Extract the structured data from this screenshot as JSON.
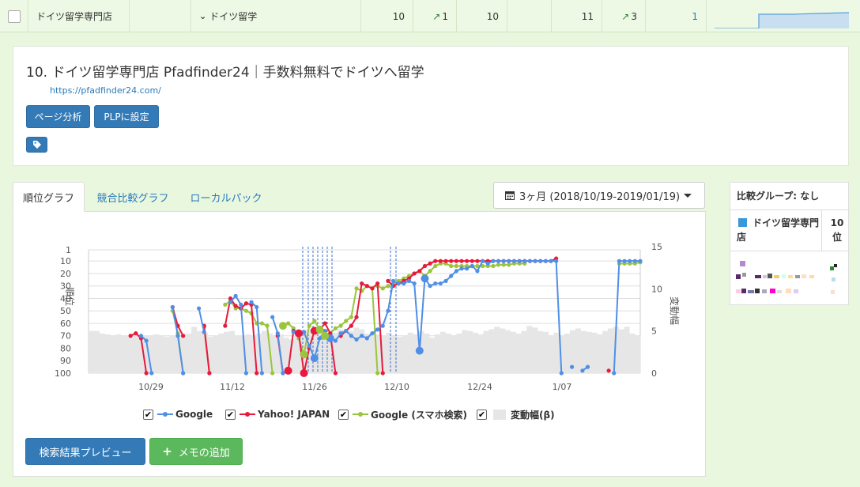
{
  "top_row": {
    "site_name": "ドイツ留学専門店",
    "keyword": "ドイツ留学",
    "rank_google": "10",
    "change_google": "1",
    "rank_yahoo": "10",
    "rank_mobile": "11",
    "change_mobile": "3",
    "count": "1"
  },
  "result": {
    "title": "10. ドイツ留学専門店 Pfadfinder24｜手数料無料でドイツへ留学",
    "url": "https://pfadfinder24.com/",
    "page_analysis_label": "ページ分析",
    "plp_label": "PLPに設定"
  },
  "tabs": [
    {
      "label": "順位グラフ"
    },
    {
      "label": "競合比較グラフ"
    },
    {
      "label": "ローカルパック"
    }
  ],
  "period": {
    "label": "3ヶ月 (2018/10/19-2019/01/19)"
  },
  "chart_data": {
    "type": "line",
    "ylabel": "順位",
    "y2label": "変動幅",
    "y_ticks": [
      "1",
      "10",
      "20",
      "30",
      "40",
      "50",
      "60",
      "70",
      "80",
      "90",
      "100"
    ],
    "y2_ticks": [
      "15",
      "10",
      "5",
      "0"
    ],
    "x_ticks": [
      "10/29",
      "11/12",
      "11/26",
      "12/10",
      "12/24",
      "1/07"
    ],
    "series": [
      {
        "name": "Google",
        "color": "#4f8fe6"
      },
      {
        "name": "Yahoo! JAPAN",
        "color": "#e8193c"
      },
      {
        "name": "Google (スマホ検索)",
        "color": "#9bc53d"
      },
      {
        "name": "変動幅(β)",
        "color": "#e6e6e6"
      }
    ],
    "volatility": [
      5,
      5,
      4.7,
      4.6,
      4.5,
      4.6,
      4.4,
      4.5,
      4.6,
      4.5,
      4.4,
      4.5,
      4.6,
      4.4,
      4.3,
      4.4,
      4.5,
      4.6,
      4.7,
      5.5,
      5,
      4.8,
      4.3,
      4.5,
      4.7,
      4.9,
      5,
      4.5,
      4.4,
      4.6,
      4.5,
      4.7,
      5,
      4.7,
      4.4,
      4.6,
      4.2,
      4,
      4.5,
      5,
      5.2,
      5,
      4.8,
      4.6,
      4.4,
      4.8,
      5.2,
      5.1,
      5,
      5.4,
      5.2,
      4.7,
      4.8,
      4.6,
      4.4,
      4.8,
      4.5,
      4.3,
      4.5,
      4.8,
      4.6,
      5,
      4.7,
      4.2,
      4.6,
      4.9,
      4.7,
      4.5,
      4.7,
      5.1,
      5,
      4.8,
      4.6,
      5,
      5.2,
      5.5,
      5.3,
      5.1,
      4.9,
      4.7,
      5,
      5.6,
      5.4,
      5,
      4.9,
      4.5,
      4.8,
      4.4,
      4.7,
      5.1,
      5.3,
      5,
      4.9,
      4.8,
      4.6,
      5,
      5.3,
      5.5,
      5.2,
      5.5,
      4.7,
      4.4
    ],
    "google_segments": [
      [
        [
          10,
          70
        ],
        [
          11,
          74
        ],
        [
          12,
          100
        ]
      ],
      [
        [
          16,
          47
        ],
        [
          17,
          70
        ],
        [
          18,
          100
        ]
      ],
      [
        [
          21,
          48
        ],
        [
          22,
          67
        ]
      ],
      [
        [
          27,
          43
        ],
        [
          28,
          38
        ],
        [
          29,
          45
        ],
        [
          30,
          100
        ]
      ],
      [
        [
          31,
          43
        ],
        [
          32,
          47
        ],
        [
          33,
          100
        ]
      ],
      [
        [
          35,
          55
        ],
        [
          36,
          68
        ],
        [
          37,
          100
        ]
      ],
      [
        [
          39,
          67
        ],
        [
          40,
          70
        ],
        [
          41,
          67
        ],
        [
          42,
          78
        ],
        [
          43,
          88
        ],
        [
          44,
          72
        ],
        [
          45,
          66
        ],
        [
          46,
          72
        ],
        [
          47,
          74
        ],
        [
          48,
          68
        ],
        [
          49,
          66
        ],
        [
          50,
          70
        ],
        [
          51,
          73
        ],
        [
          52,
          70
        ],
        [
          53,
          72
        ],
        [
          54,
          68
        ],
        [
          55,
          65
        ],
        [
          56,
          62
        ],
        [
          57,
          50
        ],
        [
          58,
          26
        ],
        [
          59,
          28
        ],
        [
          60,
          28
        ],
        [
          61,
          26
        ],
        [
          62,
          28
        ],
        [
          63,
          82
        ],
        [
          64,
          24
        ],
        [
          65,
          30
        ],
        [
          66,
          28
        ],
        [
          67,
          28
        ],
        [
          68,
          26
        ],
        [
          69,
          22
        ],
        [
          70,
          18
        ],
        [
          71,
          16
        ],
        [
          72,
          16
        ],
        [
          73,
          14
        ],
        [
          74,
          18
        ],
        [
          75,
          10
        ],
        [
          76,
          12
        ],
        [
          77,
          10
        ],
        [
          78,
          10
        ],
        [
          79,
          10
        ],
        [
          80,
          10
        ],
        [
          81,
          10
        ],
        [
          82,
          10
        ],
        [
          83,
          10
        ],
        [
          84,
          10
        ],
        [
          85,
          10
        ],
        [
          86,
          10
        ],
        [
          87,
          10
        ],
        [
          88,
          10
        ],
        [
          89,
          10
        ],
        [
          90,
          100
        ]
      ],
      [
        [
          92,
          95
        ]
      ],
      [
        [
          94,
          98
        ],
        [
          95,
          95
        ]
      ],
      [
        [
          100,
          100
        ],
        [
          101,
          10
        ],
        [
          102,
          10
        ],
        [
          103,
          10
        ],
        [
          104,
          10
        ],
        [
          105,
          10
        ]
      ]
    ],
    "yahoo_segments": [
      [
        [
          8,
          70
        ],
        [
          9,
          68
        ],
        [
          10,
          72
        ],
        [
          11,
          100
        ]
      ],
      [
        [
          16,
          47
        ],
        [
          17,
          62
        ],
        [
          18,
          70
        ]
      ],
      [
        [
          22,
          62
        ],
        [
          23,
          100
        ]
      ],
      [
        [
          26,
          62
        ],
        [
          27,
          40
        ],
        [
          28,
          46
        ],
        [
          29,
          48
        ],
        [
          30,
          44
        ],
        [
          31,
          45
        ],
        [
          32,
          100
        ]
      ],
      [
        [
          36,
          70
        ],
        [
          37,
          100
        ]
      ],
      [
        [
          38,
          98
        ],
        [
          39,
          66
        ],
        [
          40,
          68
        ],
        [
          41,
          100
        ],
        [
          42,
          80
        ],
        [
          43,
          66
        ],
        [
          44,
          65
        ],
        [
          45,
          60
        ],
        [
          46,
          68
        ],
        [
          47,
          100
        ]
      ],
      [
        [
          48,
          70
        ],
        [
          49,
          66
        ],
        [
          50,
          62
        ],
        [
          51,
          55
        ],
        [
          52,
          28
        ],
        [
          53,
          30
        ],
        [
          54,
          32
        ],
        [
          55,
          28
        ],
        [
          56,
          100
        ]
      ],
      [
        [
          57,
          26
        ],
        [
          58,
          30
        ],
        [
          59,
          28
        ],
        [
          60,
          26
        ],
        [
          61,
          24
        ],
        [
          62,
          20
        ],
        [
          63,
          18
        ],
        [
          64,
          14
        ],
        [
          65,
          12
        ],
        [
          66,
          10
        ],
        [
          67,
          10
        ],
        [
          68,
          10
        ],
        [
          69,
          10
        ],
        [
          70,
          10
        ],
        [
          71,
          10
        ],
        [
          72,
          10
        ],
        [
          73,
          10
        ],
        [
          74,
          10
        ],
        [
          75,
          10
        ],
        [
          76,
          10
        ],
        [
          77,
          10
        ],
        [
          78,
          10
        ],
        [
          79,
          10
        ],
        [
          80,
          10
        ],
        [
          81,
          10
        ],
        [
          82,
          10
        ],
        [
          83,
          10
        ],
        [
          84,
          10
        ],
        [
          85,
          10
        ],
        [
          86,
          10
        ],
        [
          87,
          10
        ],
        [
          88,
          10
        ],
        [
          89,
          8
        ]
      ],
      [
        [
          99,
          98
        ]
      ]
    ],
    "mobile_segments": [
      [
        [
          16,
          50
        ],
        [
          17,
          68
        ],
        [
          18,
          100
        ]
      ],
      [
        [
          22,
          63
        ],
        [
          23,
          100
        ]
      ],
      [
        [
          26,
          45
        ],
        [
          27,
          42
        ],
        [
          28,
          48
        ],
        [
          29,
          48
        ],
        [
          30,
          50
        ],
        [
          31,
          52
        ],
        [
          32,
          60
        ],
        [
          33,
          60
        ],
        [
          34,
          62
        ],
        [
          35,
          100
        ]
      ],
      [
        [
          37,
          62
        ],
        [
          38,
          60
        ],
        [
          39,
          64
        ],
        [
          40,
          72
        ],
        [
          41,
          85
        ],
        [
          42,
          62
        ],
        [
          43,
          58
        ],
        [
          44,
          65
        ],
        [
          45,
          70
        ],
        [
          46,
          68
        ],
        [
          47,
          64
        ],
        [
          48,
          62
        ],
        [
          49,
          58
        ],
        [
          50,
          55
        ],
        [
          51,
          32
        ],
        [
          52,
          34
        ],
        [
          53,
          30
        ],
        [
          54,
          32
        ],
        [
          55,
          100
        ]
      ],
      [
        [
          55,
          30
        ],
        [
          56,
          32
        ],
        [
          57,
          30
        ],
        [
          58,
          28
        ],
        [
          59,
          26
        ],
        [
          60,
          24
        ],
        [
          61,
          22
        ],
        [
          62,
          20
        ],
        [
          63,
          18
        ],
        [
          64,
          22
        ],
        [
          65,
          18
        ],
        [
          66,
          14
        ],
        [
          67,
          12
        ],
        [
          68,
          12
        ],
        [
          69,
          14
        ],
        [
          70,
          14
        ],
        [
          71,
          14
        ],
        [
          72,
          14
        ],
        [
          73,
          14
        ],
        [
          74,
          14
        ],
        [
          75,
          14
        ],
        [
          76,
          14
        ],
        [
          77,
          14
        ],
        [
          78,
          13
        ],
        [
          79,
          13
        ],
        [
          80,
          13
        ],
        [
          81,
          12
        ],
        [
          82,
          12
        ],
        [
          83,
          12
        ]
      ],
      [
        [
          101,
          12
        ],
        [
          102,
          12
        ],
        [
          103,
          12
        ],
        [
          104,
          12
        ],
        [
          105,
          11
        ]
      ]
    ]
  },
  "actions": {
    "preview_label": "検索結果プレビュー",
    "memo_label": "メモの追加"
  },
  "compare": {
    "header": "比較グループ: なし",
    "site_label": "ドイツ留学専門店",
    "rank_label": "10位"
  }
}
